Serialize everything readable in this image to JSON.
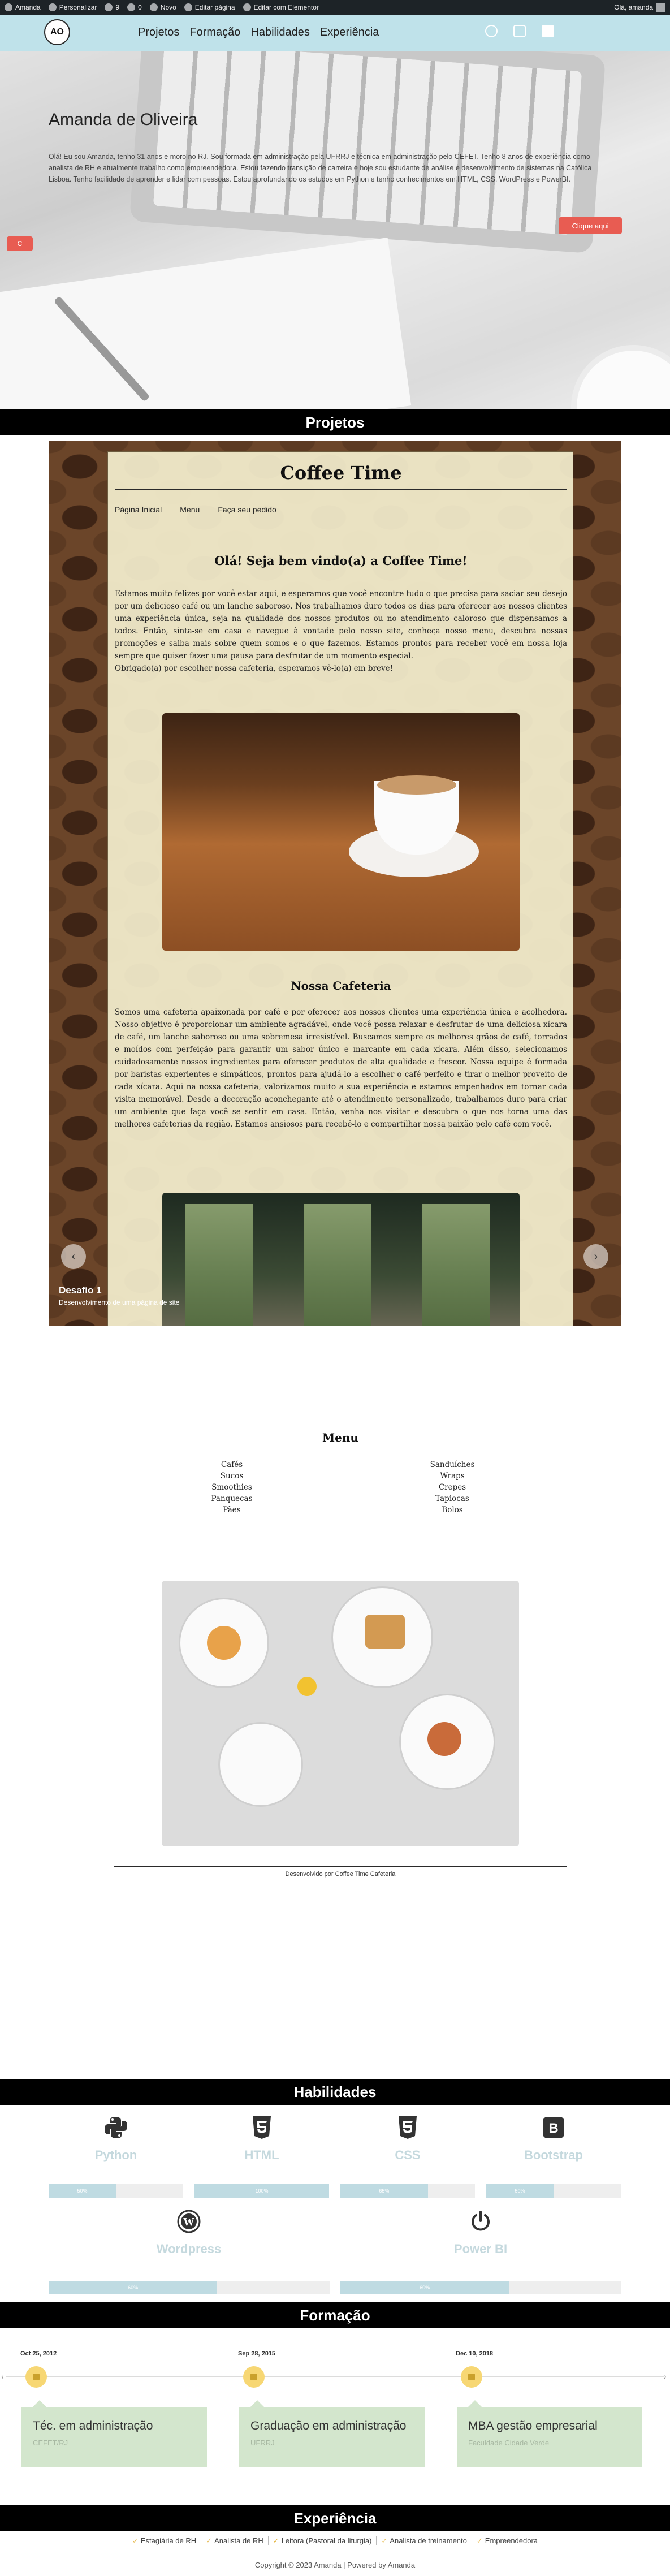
{
  "adminbar": {
    "items": [
      "Amanda",
      "Personalizar",
      "9",
      "0",
      "Novo",
      "Editar página",
      "Editar com Elementor"
    ],
    "greeting": "Olá, amanda"
  },
  "header": {
    "logo": "AO",
    "nav": [
      "Projetos",
      "Formação",
      "Habilidades",
      "Experiência"
    ],
    "social_icons": [
      "github-icon",
      "instagram-icon",
      "linkedin-icon"
    ]
  },
  "hero": {
    "name": "Amanda de Oliveira",
    "bio": "Olá! Eu sou Amanda, tenho 31 anos e moro no RJ. Sou formada em administração pela UFRRJ e técnica em administração pelo CEFET. Tenho 8 anos de experiência como analista de RH e atualmente trabalho como empreendedora. Estou fazendo transição de carreira e hoje sou estudante de análise e desenvolvimento de sistemas na Católica Lisboa. Tenho facilidade de aprender e lidar com pessoas. Estou aprofundando os estudos em Python e tenho conhecimentos em HTML, CSS, WordPress e PowerBI.",
    "button": "Clique aqui",
    "small_button": "C"
  },
  "sections": {
    "projetos": "Projetos",
    "habilidades": "Habilidades",
    "formacao": "Formação",
    "experiencia": "Experiência"
  },
  "project": {
    "site_title": "Coffee Time",
    "nav": [
      "Página Inicial",
      "Menu",
      "Faça seu pedido"
    ],
    "welcome_title": "Olá! Seja bem vindo(a) a Coffee Time!",
    "welcome_text": "Estamos muito felizes por você estar aqui, e esperamos que você encontre tudo o que precisa para saciar seu desejo por um delicioso café ou um lanche saboroso. Nos trabalhamos duro todos os dias para oferecer aos nossos clientes uma experiência única, seja na qualidade dos nossos produtos ou no atendimento caloroso que dispensamos a todos. Então, sinta-se em casa e navegue à vontade pelo nosso site, conheça nosso menu, descubra nossas promoções e saiba mais sobre quem somos e o que fazemos. Estamos prontos para receber você em nossa loja sempre que quiser fazer uma pausa para desfrutar de um momento especial.",
    "welcome_thanks": "Obrigado(a) por escolher nossa cafeteria, esperamos vê-lo(a) em breve!",
    "about_title": "Nossa Cafeteria",
    "about_text": "Somos uma cafeteria apaixonada por café e por oferecer aos nossos clientes uma experiência única e acolhedora. Nosso objetivo é proporcionar um ambiente agradável, onde você possa relaxar e desfrutar de uma deliciosa xícara de café, um lanche saboroso ou uma sobremesa irresistível. Buscamos sempre os melhores grãos de café, torrados e moídos com perfeição para garantir um sabor único e marcante em cada xícara. Além disso, selecionamos cuidadosamente nossos ingredientes para oferecer produtos de alta qualidade e frescor. Nossa equipe é formada por baristas experientes e simpáticos, prontos para ajudá-lo a escolher o café perfeito e tirar o melhor proveito de cada xícara. Aqui na nossa cafeteria, valorizamos muito a sua experiência e estamos empenhados em tornar cada visita memorável. Desde a decoração aconchegante até o atendimento personalizado, trabalhamos duro para criar um ambiente que faça você se sentir em casa. Então, venha nos visitar e descubra o que nos torna uma das melhores cafeterias da região. Estamos ansiosos para recebê-lo e compartilhar nossa paixão pelo café com você.",
    "menu_title": "Menu",
    "menu_left": [
      "Cafés",
      "Sucos",
      "Smoothies",
      "Panquecas",
      "Pães"
    ],
    "menu_right": [
      "Sanduíches",
      "Wraps",
      "Crepes",
      "Tapiocas",
      "Bolos"
    ],
    "footer": "Desenvolvido por Coffee Time Cafeteria",
    "caption_title": "Desafio 1",
    "caption_desc": "Desenvolvimento de uma página de site"
  },
  "skills": [
    {
      "name": "Python",
      "icon": "python-icon",
      "percent": 50,
      "label": "50%"
    },
    {
      "name": "HTML",
      "icon": "html5-icon",
      "percent": 100,
      "label": "100%"
    },
    {
      "name": "CSS",
      "icon": "css3-icon",
      "percent": 65,
      "label": "65%"
    },
    {
      "name": "Bootstrap",
      "icon": "bootstrap-icon",
      "percent": 50,
      "label": "50%"
    },
    {
      "name": "Wordpress",
      "icon": "wordpress-icon",
      "percent": 60,
      "label": "60%"
    },
    {
      "name": "Power BI",
      "icon": "power-icon",
      "percent": 60,
      "label": "60%"
    }
  ],
  "timeline": [
    {
      "date": "Oct 25, 2012",
      "title": "Téc. em administração",
      "subtitle": "CEFET/RJ"
    },
    {
      "date": "Sep 28, 2015",
      "title": "Graduação em administração",
      "subtitle": "UFRRJ"
    },
    {
      "date": "Dec 10, 2018",
      "title": "MBA gestão empresarial",
      "subtitle": "Faculdade Cidade Verde"
    }
  ],
  "experience": [
    "Estagiária de RH",
    "Analista de RH",
    "Leitora (Pastoral da liturgia)",
    "Analista de treinamento",
    "Empreendedora"
  ],
  "copyright": "Copyright © 2023 Amanda | Powered by Amanda",
  "colors": {
    "accent": "#e85c52",
    "nav_bg": "#bfe2ea",
    "skill_bar": "#bfdbe2",
    "timeline_card": "#d3e6cd",
    "timeline_dot": "#f7d774"
  }
}
